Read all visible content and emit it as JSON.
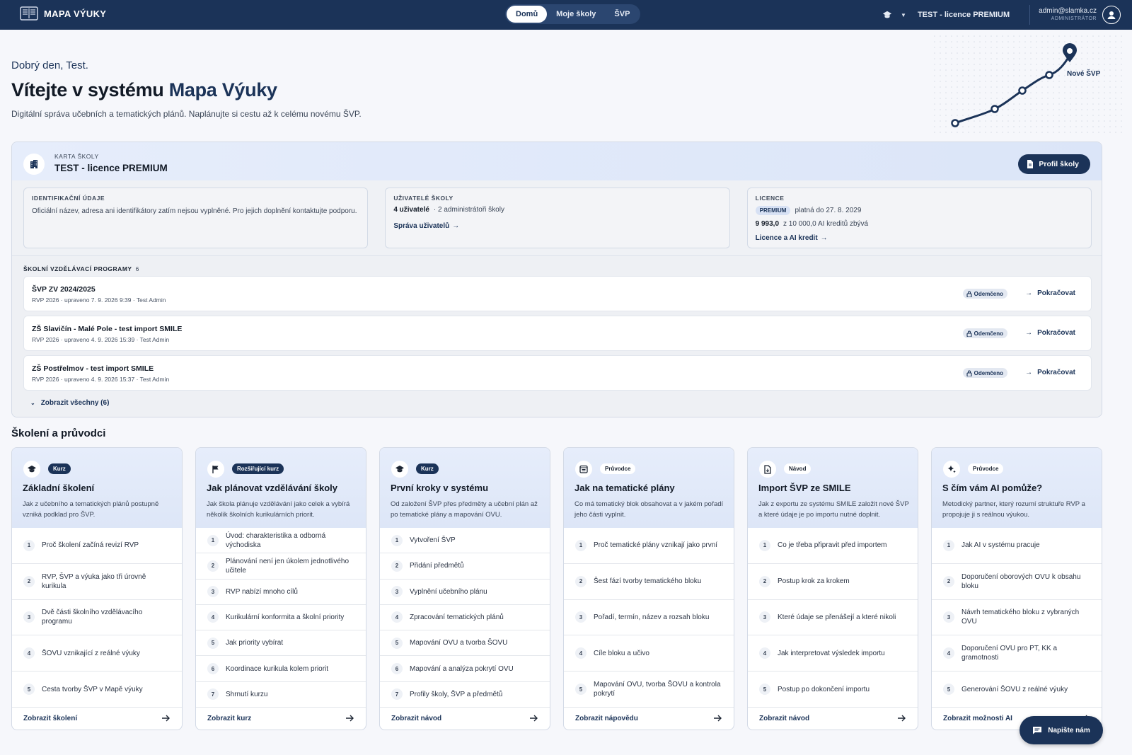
{
  "header": {
    "brand": "MAPA VÝUKY",
    "nav": [
      "Domů",
      "Moje školy",
      "ŠVP"
    ],
    "school": "TEST - licence PREMIUM",
    "user_email": "admin@slamka.cz",
    "user_role": "ADMINISTRÁTOR"
  },
  "hero": {
    "greeting": "Dobrý den, Test.",
    "title_prefix": "Vítejte v systému ",
    "title_accent": "Mapa Výuky",
    "subtitle": "Digitální správa učebních a tematických plánů. Naplánujte si cestu až k celému novému ŠVP.",
    "graphic_label": "Nové ŠVP"
  },
  "school_card": {
    "kicker": "KARTA ŠKOLY",
    "name": "TEST - licence PREMIUM",
    "profile_button": "Profil školy",
    "ident": {
      "label": "IDENTIFIKAČNÍ ÚDAJE",
      "text": "Oficiální název, adresa ani identifikátory zatím nejsou vyplněné. Pro jejich doplnění kontaktujte podporu."
    },
    "users": {
      "label": "UŽIVATELÉ ŠKOLY",
      "count": "4 uživatelé",
      "detail": "· 2 administrátoři školy",
      "link": "Správa uživatelů"
    },
    "license": {
      "label": "LICENCE",
      "badge": "PREMIUM",
      "valid": "platná do 27. 8. 2029",
      "credits_bold": "9 993,0",
      "credits_rest": "z 10 000,0 AI kreditů zbývá",
      "link": "Licence a AI kredit"
    },
    "svp": {
      "label": "ŠKOLNÍ VZDĚLÁVACÍ PROGRAMY",
      "count": "6",
      "items": [
        {
          "title": "ŠVP ZV 2024/2025",
          "meta": "RVP 2026 · upraveno 7. 9. 2026 9:39 · Test Admin",
          "status": "Odemčeno",
          "action": "Pokračovat"
        },
        {
          "title": "ZŠ Slavičín - Malé Pole - test import SMILE",
          "meta": "RVP 2026 · upraveno 4. 9. 2026 15:39 · Test Admin",
          "status": "Odemčeno",
          "action": "Pokračovat"
        },
        {
          "title": "ZŠ Postřelmov - test import SMILE",
          "meta": "RVP 2026 · upraveno 4. 9. 2026 15:37 · Test Admin",
          "status": "Odemčeno",
          "action": "Pokračovat"
        }
      ],
      "show_all": "Zobrazit všechny (6)"
    }
  },
  "training": {
    "title": "Školení a průvodci",
    "cards": [
      {
        "icon": "graduation-cap-icon",
        "tag": "Kurz",
        "tag_style": "dark",
        "title": "Základní školení",
        "desc": "Jak z učebního a tematických plánů postupně vzniká podklad pro ŠVP.",
        "items": [
          "Proč školení začíná revizí RVP",
          "RVP, ŠVP a výuka jako tři úrovně kurikula",
          "Dvě části školního vzdělávacího programu",
          "ŠOVU vznikající z reálné výuky",
          "Cesta tvorby ŠVP v Mapě výuky"
        ],
        "footer": "Zobrazit školení"
      },
      {
        "icon": "flag-icon",
        "tag": "Rozšiřující kurz",
        "tag_style": "dark",
        "title": "Jak plánovat vzdělávání školy",
        "desc": "Jak škola plánuje vzdělávání jako celek a vybírá několik školních kurikulárních priorit.",
        "items": [
          "Úvod: charakteristika a odborná východiska",
          "Plánování není jen úkolem jednotlivého učitele",
          "RVP nabízí mnoho cílů",
          "Kurikulární konformita a školní priority",
          "Jak priority vybírat",
          "Koordinace kurikula kolem priorit",
          "Shrnutí kurzu"
        ],
        "footer": "Zobrazit kurz"
      },
      {
        "icon": "graduation-cap-icon",
        "tag": "Kurz",
        "tag_style": "dark",
        "title": "První kroky v systému",
        "desc": "Od založení ŠVP přes předměty a učební plán až po tematické plány a mapování OVU.",
        "items": [
          "Vytvoření ŠVP",
          "Přidání předmětů",
          "Vyplnění učebního plánu",
          "Zpracování tematických plánů",
          "Mapování OVU a tvorba ŠOVU",
          "Mapování a analýza pokrytí OVU",
          "Profily školy, ŠVP a předmětů"
        ],
        "footer": "Zobrazit návod"
      },
      {
        "icon": "calendar-list-icon",
        "tag": "Průvodce",
        "tag_style": "light",
        "title": "Jak na tematické plány",
        "desc": "Co má tematický blok obsahovat a v jakém pořadí jeho části vyplnit.",
        "items": [
          "Proč tematické plány vznikají jako první",
          "Šest fází tvorby tematického bloku",
          "Pořadí, termín, název a rozsah bloku",
          "Cíle bloku a učivo",
          "Mapování OVU, tvorba ŠOVU a kontrola pokrytí"
        ],
        "footer": "Zobrazit nápovědu"
      },
      {
        "icon": "file-import-icon",
        "tag": "Návod",
        "tag_style": "light",
        "title": "Import ŠVP ze SMILE",
        "desc": "Jak z exportu ze systému SMILE založit nové ŠVP a které údaje je po importu nutné doplnit.",
        "items": [
          "Co je třeba připravit před importem",
          "Postup krok za krokem",
          "Které údaje se přenášejí a které nikoli",
          "Jak interpretovat výsledek importu",
          "Postup po dokončení importu"
        ],
        "footer": "Zobrazit návod"
      },
      {
        "icon": "sparkle-icon",
        "tag": "Průvodce",
        "tag_style": "light",
        "title": "S čím vám AI pomůže?",
        "desc": "Metodický partner, který rozumí struktuře RVP a propojuje ji s reálnou výukou.",
        "items": [
          "Jak AI v systému pracuje",
          "Doporučení oborových OVU k obsahu bloku",
          "Návrh tematického bloku z vybraných OVU",
          "Doporučení OVU pro PT, KK a gramotnosti",
          "Generování ŠOVU z reálné výuky"
        ],
        "footer": "Zobrazit možnosti AI"
      }
    ]
  },
  "chat": {
    "label": "Napište nám"
  },
  "colors": {
    "primary": "#1b3358",
    "background": "#f6f7fb",
    "card_head": "#e6edfb"
  }
}
